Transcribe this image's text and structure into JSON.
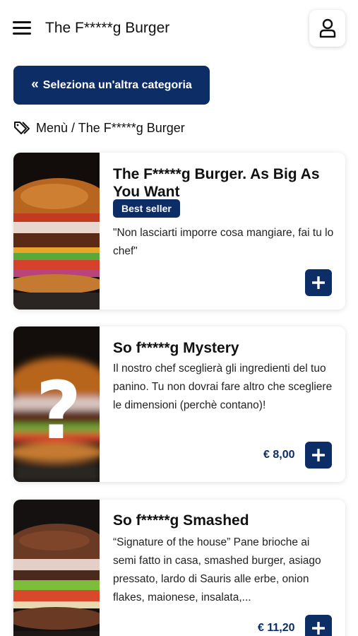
{
  "header": {
    "title": "The F*****g Burger"
  },
  "category_button": {
    "label": "Seleziona un'altra categoria"
  },
  "breadcrumb": {
    "text": "Menù / The F*****g Burger"
  },
  "products": [
    {
      "title": "The F*****g Burger. As Big As You Want",
      "badge": "Best seller",
      "description": "\"Non lasciarti imporre cosa mangiare, fai tu lo chef\"",
      "price": ""
    },
    {
      "title": "So f*****g Mystery",
      "description": "Il nostro chef sceglierà gli ingredienti del tuo panino. Tu non dovrai fare altro che scegliere le dimensioni (perchè contano)!",
      "price": "€ 8,00"
    },
    {
      "title": "So f*****g Smashed",
      "description": "“Signature of the house” Pane brioche ai semi fatto in casa, smashed burger, asiago pressato, lardo di Sauris alle erbe, onion flakes, maionese, insalata,...",
      "price": "€ 11,20"
    }
  ],
  "colors": {
    "primary": "#0d2d66",
    "card_bg": "#ffffff"
  },
  "icons": {
    "menu": "hamburger-menu-icon",
    "user": "user-icon",
    "back": "double-chevron-left-icon",
    "tag": "tag-icon",
    "add": "plus-icon"
  }
}
